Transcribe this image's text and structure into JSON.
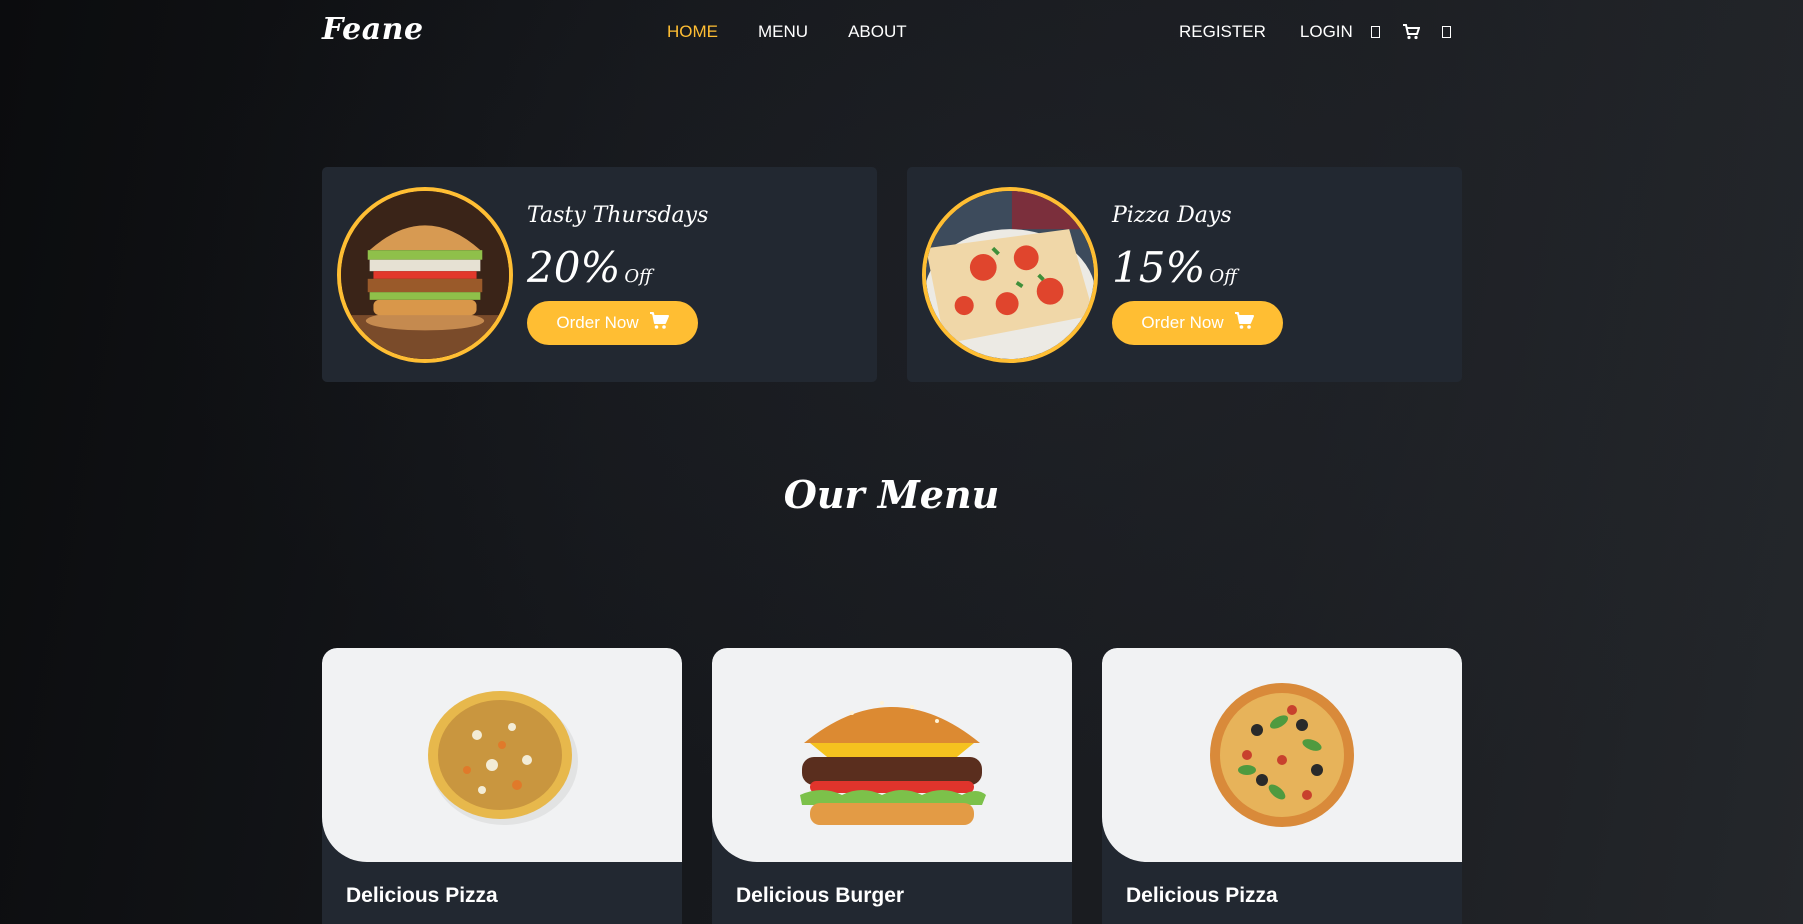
{
  "brand": "Feane",
  "nav": {
    "home": "HOME",
    "menu": "MENU",
    "about": "ABOUT"
  },
  "user_nav": {
    "register": "REGISTER",
    "login": "LOGIN"
  },
  "header_icons": [
    "user-icon",
    "cart-icon",
    "search-icon"
  ],
  "offers": [
    {
      "title": "Tasty Thursdays",
      "percent": "20%",
      "off": "Off",
      "button": "Order Now",
      "image": "burger-photo"
    },
    {
      "title": "Pizza Days",
      "percent": "15%",
      "off": "Off",
      "button": "Order Now",
      "image": "pizza-photo"
    }
  ],
  "menu_heading": "Our Menu",
  "menu_items": [
    {
      "title": "Delicious Pizza",
      "subtitle": ""
    },
    {
      "title": "Delicious Burger",
      "subtitle": ""
    },
    {
      "title": "Delicious Pizza",
      "subtitle": ""
    }
  ],
  "colors": {
    "accent": "#ffbe33",
    "card_bg": "#222831",
    "image_bg": "#f1f2f3"
  }
}
